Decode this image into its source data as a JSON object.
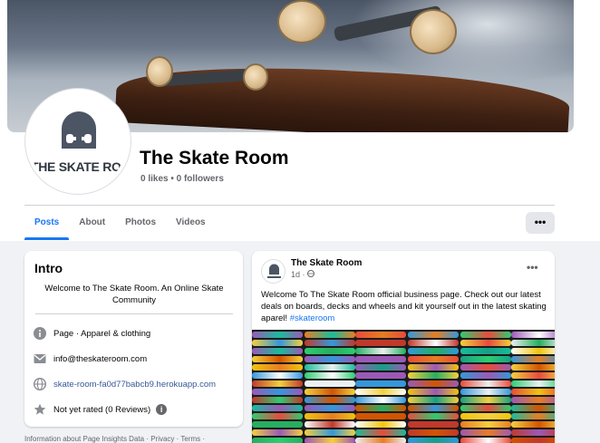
{
  "page": {
    "name": "The Skate Room",
    "logo_text": "THE SKATE ROOM",
    "stats": "0 likes • 0 followers"
  },
  "tabs": [
    {
      "label": "Posts",
      "active": true
    },
    {
      "label": "About",
      "active": false
    },
    {
      "label": "Photos",
      "active": false
    },
    {
      "label": "Videos",
      "active": false
    }
  ],
  "more_label": "•••",
  "intro": {
    "title": "Intro",
    "bio": "Welcome to The Skate Room. An Online Skate Community",
    "category": "Page · Apparel & clothing",
    "email": "info@theskateroom.com",
    "website": "skate-room-fa0d77babcb9.herokuapp.com",
    "rating": "Not yet rated (0 Reviews)",
    "info_glyph": "i"
  },
  "footer": "Information about Page Insights Data · Privacy · Terms ·",
  "post": {
    "author": "The Skate Room",
    "time": "1d ·",
    "text": "Welcome To The Skate Room official business page. Check out our latest deals on boards, decks and wheels and kit yourself out in the latest skating aparel!",
    "hashtag": "#skateroom",
    "more_label": "•••"
  },
  "colors": {
    "accent": "#1877f2",
    "link": "#385898",
    "muted": "#65676b",
    "background": "#f0f2f5",
    "logo": "#4b5563"
  },
  "icons": {
    "category": "info-circle-icon",
    "email": "envelope-icon",
    "website": "globe-icon",
    "rating": "star-icon",
    "public": "globe-small-icon"
  }
}
